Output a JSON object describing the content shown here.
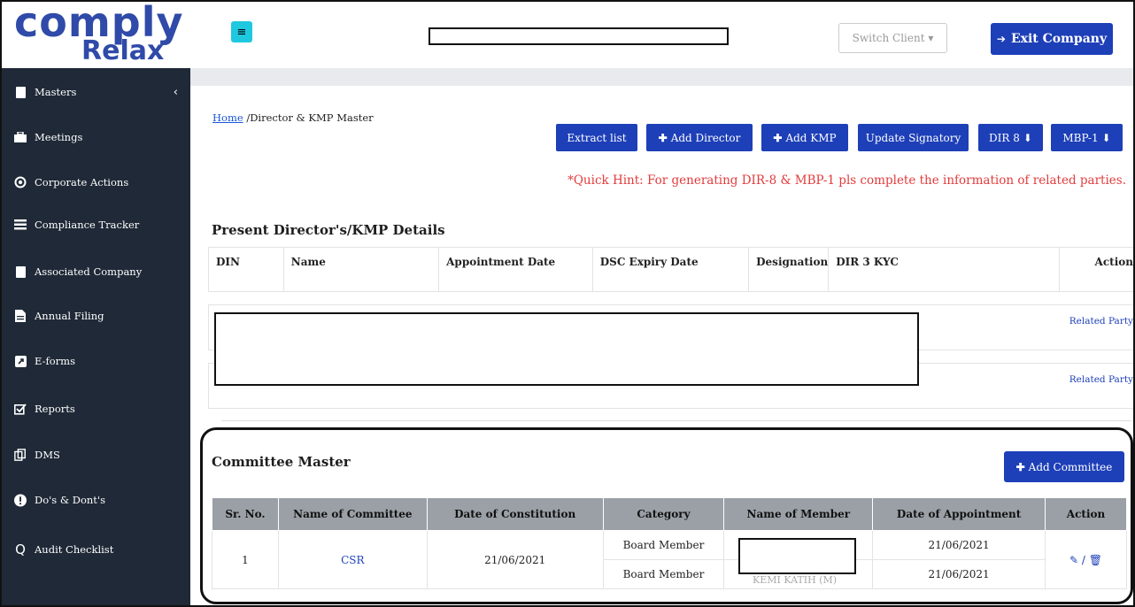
{
  "brand": {
    "logo_top": "comply",
    "logo_bottom": "Relax"
  },
  "sidebar": {
    "items": [
      {
        "label": "Masters",
        "icon": "building-icon"
      },
      {
        "label": "Meetings",
        "icon": "briefcase-icon"
      },
      {
        "label": "Corporate Actions",
        "icon": "circle-dot-icon"
      },
      {
        "label": "Compliance Tracker",
        "icon": "list-icon"
      },
      {
        "label": "Associated Company",
        "icon": "building-icon"
      },
      {
        "label": "Annual Filing",
        "icon": "file-icon"
      },
      {
        "label": "E-forms",
        "icon": "external-link-icon"
      },
      {
        "label": "Reports",
        "icon": "checkbox-icon"
      },
      {
        "label": "DMS",
        "icon": "copy-icon"
      },
      {
        "label": "Do's & Dont's",
        "icon": "exclamation-icon"
      },
      {
        "label": "Audit Checklist",
        "icon": "q-icon"
      }
    ],
    "masters_chevron": "‹"
  },
  "header": {
    "menu_icon": "≡",
    "switch_client": "Switch Client ▾",
    "exit_company": "Exit Company"
  },
  "breadcrumb": {
    "home": "Home",
    "current": " /Director & KMP Master"
  },
  "toolbar": {
    "extract": "Extract list",
    "add_director": "Add Director",
    "add_kmp": "Add KMP",
    "update_signatory": "Update Signatory",
    "dir8": "DIR 8",
    "mbp1": "MBP-1"
  },
  "hint": "*Quick Hint: For generating DIR-8 & MBP-1 pls complete the information of related parties.",
  "directors": {
    "title": "Present Director's/KMP Details",
    "columns": [
      "DIN",
      "Name",
      "Appointment Date",
      "DSC Expiry Date",
      "Designation",
      "DIR 3 KYC",
      "Action"
    ],
    "rows": [
      {
        "action": "Related Party"
      },
      {
        "action": "Related Party"
      }
    ]
  },
  "committee": {
    "title": "Committee Master",
    "add_label": "Add Committee",
    "columns": [
      "Sr. No.",
      "Name of Committee",
      "Date of Constitution",
      "Category",
      "Name of Member",
      "Date of Appointment",
      "Action"
    ],
    "rows": [
      {
        "sr": "1",
        "name": "CSR",
        "constitution": "21/06/2021",
        "members": [
          {
            "category": "Board Member",
            "appointment": "21/06/2021"
          },
          {
            "category": "Board Member",
            "member_partial": "KEMI KATIH (M)",
            "appointment": "21/06/2021"
          }
        ],
        "action_sep": "/"
      }
    ]
  },
  "colors": {
    "sidebar_bg": "#1f2937",
    "primary": "#1d3fb8",
    "hint": "#e23b3b",
    "menu_btn": "#1ec8df",
    "table_head": "#9aa0a6"
  }
}
